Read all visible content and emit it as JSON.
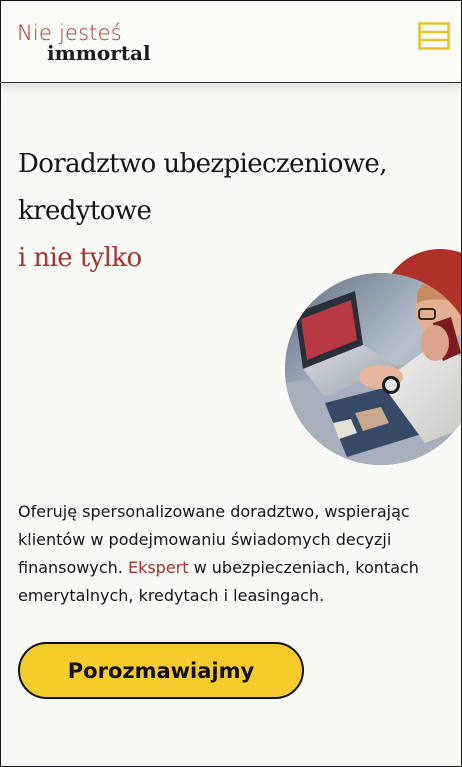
{
  "header": {
    "logo_line1": "Nie jesteś",
    "logo_line2": "immortal",
    "menu_icon": "hamburger-menu-icon"
  },
  "hero": {
    "title_line1": "Doradztwo ubezpieczeniowe,",
    "title_line2": "kredytowe",
    "title_line3": "i nie tylko"
  },
  "description": {
    "text_before": "Oferuję spersonalizowane doradztwo, wspierając klientów w podejmowaniu świadomych decyzji finansowych. ",
    "highlight": "Ekspert",
    "text_after": " w ubezpieczeniach, kontach emerytalnych, kredytach i leasingach."
  },
  "cta": {
    "label": "Porozmawiajmy"
  },
  "colors": {
    "accent": "#a8322d",
    "button": "#f5cc2c",
    "menu_icon": "#e8c12c",
    "background": "#f9f9f5"
  }
}
